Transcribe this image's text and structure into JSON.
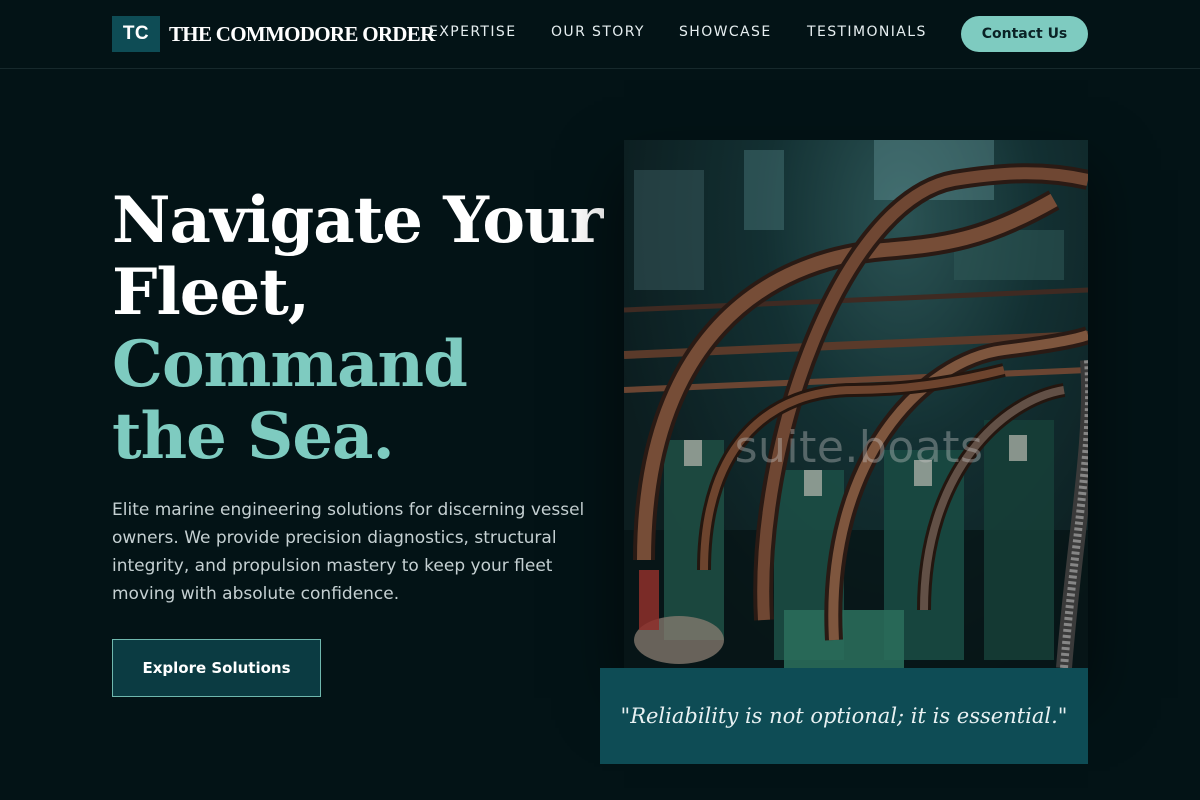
{
  "header": {
    "brand_badge": "TC",
    "brand_name": "THE COMMODORE ORDER",
    "nav": [
      {
        "label": "EXPERTISE"
      },
      {
        "label": "OUR STORY"
      },
      {
        "label": "SHOWCASE"
      },
      {
        "label": "TESTIMONIALS"
      }
    ],
    "contact_label": "Contact Us"
  },
  "hero": {
    "title_lines": [
      "Navigate Your",
      "Fleet,",
      "Command",
      "the Sea."
    ],
    "description": "Elite marine engineering solutions for discerning vessel owners. We provide precision diagnostics, structural integrity, and propulsion mastery to keep your fleet moving with absolute confidence.",
    "cta_label": "Explore Solutions"
  },
  "image": {
    "watermark": "suite.boats",
    "subject_icon": "engine-room-pipes-photo"
  },
  "quote": {
    "text": "\"Reliability is not optional; it is essential.\""
  },
  "colors": {
    "background": "#031316",
    "accent": "#7ecbc0",
    "teal_dark": "#0e4c55"
  }
}
